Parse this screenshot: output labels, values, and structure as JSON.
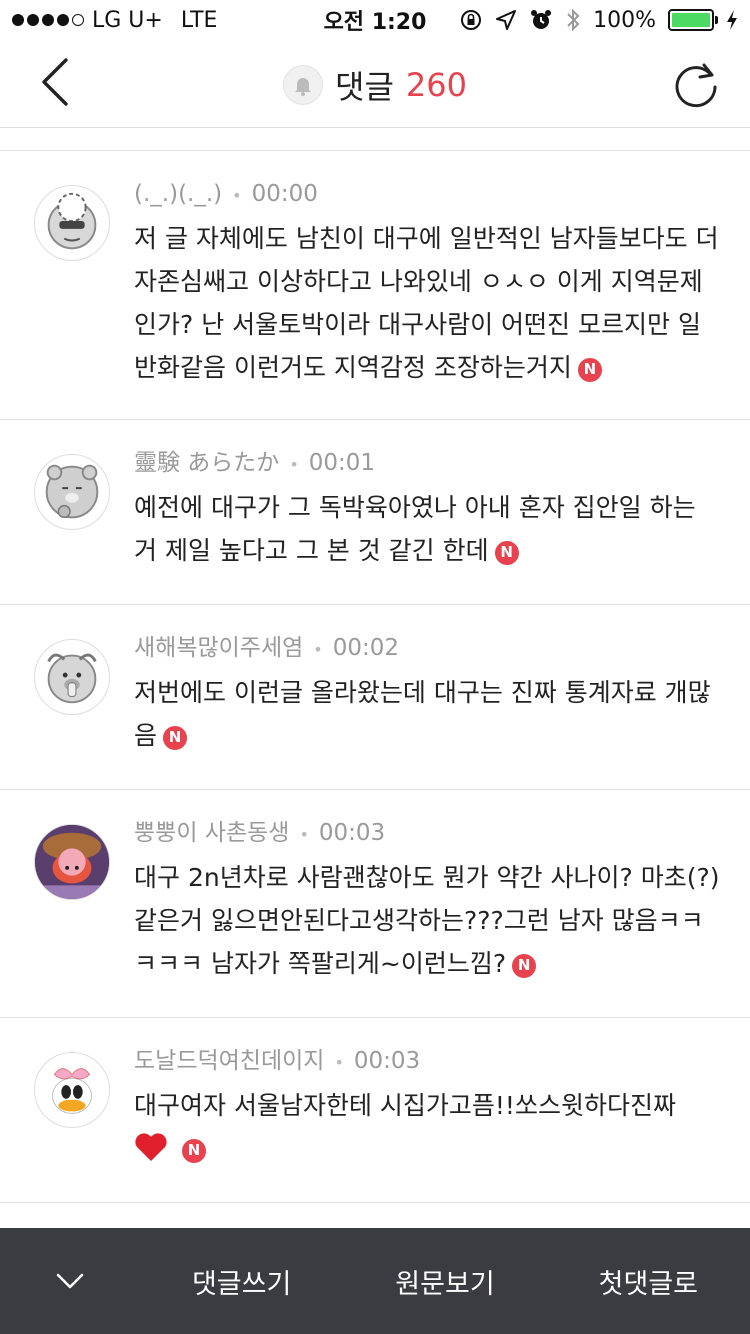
{
  "status_bar": {
    "carrier": "LG U+",
    "network": "LTE",
    "time": "오전 1:20",
    "battery": "100%",
    "battery_color": "#4cd964"
  },
  "header": {
    "title": "댓글",
    "count": "260",
    "count_color": "#e8424e",
    "icons": [
      "back-chevron-icon",
      "bell-icon",
      "refresh-icon"
    ]
  },
  "comments": [
    {
      "author": "(._.)(._.)",
      "time": "00:00",
      "text": "저 글 자체에도 남친이 대구에 일반적인 남자들보다도 더 자존심쌔고 이상하다고 나와있네 ㅇㅅㅇ 이게 지역문제인가? 난 서울토박이라 대구사람이 어떤진 모르지만 일반화같음 이런거도 지역감정 조장하는거지",
      "badge": "N"
    },
    {
      "author": "靈験 あらたか",
      "time": "00:01",
      "text": "예전에 대구가 그 독박육아였나 아내 혼자 집안일 하는 거 제일 높다고 그 본 것 같긴 한데",
      "badge": "N"
    },
    {
      "author": "새해복많이주세염",
      "time": "00:02",
      "text": "저번에도 이런글 올라왔는데 대구는 진짜 통계자료 개많음",
      "badge": "N"
    },
    {
      "author": "뿡뿡이 사촌동생",
      "time": "00:03",
      "text": "대구 2n년차로 사람괜찮아도 뭔가 약간 사나이? 마초(?)같은거 잃으면안된다고생각하는???그런 남자 많음ㅋㅋㅋㅋㅋ 남자가 쪽팔리게~이런느낌?",
      "badge": "N"
    },
    {
      "author": "도날드덕여친데이지",
      "time": "00:03",
      "text": "대구여자 서울남자한테 시집가고픔!!쏘스윗하다진짜",
      "badge": "N",
      "emoji": "heart-icon"
    }
  ],
  "bottom_bar": {
    "collapse_icon": "chevron-down-icon",
    "write": "댓글쓰기",
    "original": "원문보기",
    "first": "첫댓글로",
    "bg_color": "#3b3c42"
  }
}
